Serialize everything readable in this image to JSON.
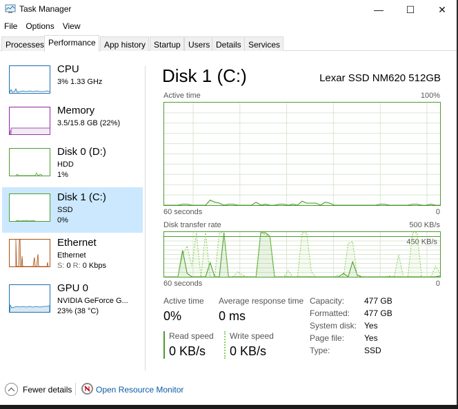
{
  "window": {
    "title": "Task Manager",
    "controls": {
      "minimize": "—",
      "maximize": "☐",
      "close": "✕"
    }
  },
  "menu": [
    "File",
    "Options",
    "View"
  ],
  "tabs": [
    {
      "label": "Processes",
      "active": false
    },
    {
      "label": "Performance",
      "active": true
    },
    {
      "label": "App history",
      "active": false
    },
    {
      "label": "Startup",
      "active": false
    },
    {
      "label": "Users",
      "active": false
    },
    {
      "label": "Details",
      "active": false
    },
    {
      "label": "Services",
      "active": false
    }
  ],
  "sidebar": {
    "items": [
      {
        "name": "CPU",
        "line1": "3% 1.33 GHz",
        "line2": "",
        "color": "#1a6ea8",
        "selected": false
      },
      {
        "name": "Memory",
        "line1": "3.5/15.8 GB (22%)",
        "line2": "",
        "color": "#8b26a0",
        "selected": false
      },
      {
        "name": "Disk 0 (D:)",
        "line1": "HDD",
        "line2": "1%",
        "color": "#4d9a2f",
        "selected": false
      },
      {
        "name": "Disk 1 (C:)",
        "line1": "SSD",
        "line2": "0%",
        "color": "#4d9a2f",
        "selected": true
      },
      {
        "name": "Ethernet",
        "line1": "Ethernet",
        "line2_send_label": "S:",
        "line2_send": "0",
        "line2_recv_label": "R:",
        "line2_recv": "0 Kbps",
        "color": "#a74f0f",
        "selected": false
      },
      {
        "name": "GPU 0",
        "line1": "NVIDIA GeForce G...",
        "line2": "23% (38 °C)",
        "color": "#1a6ea8",
        "selected": false
      }
    ]
  },
  "main": {
    "title": "Disk 1 (C:)",
    "model": "Lexar SSD NM620 512GB",
    "active_chart": {
      "label": "Active time",
      "max_label": "100%",
      "x_left": "60 seconds",
      "x_right": "0"
    },
    "transfer_chart": {
      "label": "Disk transfer rate",
      "max_label": "500 KB/s",
      "ref_label": "450 KB/s",
      "x_left": "60 seconds",
      "x_right": "0"
    },
    "stats": {
      "active_time_label": "Active time",
      "active_time_value": "0%",
      "avg_response_label": "Average response time",
      "avg_response_value": "0 ms",
      "read_label": "Read speed",
      "read_value": "0 KB/s",
      "write_label": "Write speed",
      "write_value": "0 KB/s"
    },
    "info": [
      {
        "key": "Capacity:",
        "value": "477 GB"
      },
      {
        "key": "Formatted:",
        "value": "477 GB"
      },
      {
        "key": "System disk:",
        "value": "Yes"
      },
      {
        "key": "Page file:",
        "value": "Yes"
      },
      {
        "key": "Type:",
        "value": "SSD"
      }
    ]
  },
  "footer": {
    "fewer_details": "Fewer details",
    "resource_monitor": "Open Resource Monitor"
  },
  "chart_data": [
    {
      "type": "line",
      "title": "Active time",
      "ylabel": "%",
      "ylim": [
        0,
        100
      ],
      "xlim": [
        60,
        0
      ],
      "xlabel_left": "60 seconds",
      "xlabel_right": "0",
      "series": [
        {
          "name": "Active time",
          "color": "#4d9a2f",
          "values": [
            0,
            0,
            0,
            0,
            1,
            1,
            0,
            0,
            0,
            0,
            5,
            3,
            2,
            0,
            1,
            1,
            0,
            0,
            0,
            0,
            3,
            0,
            1,
            0,
            0,
            1,
            1,
            0,
            1,
            0,
            4,
            2,
            2,
            2,
            0,
            3,
            2,
            0,
            0,
            0,
            0,
            0,
            0,
            0,
            0,
            0,
            0,
            1,
            1,
            0,
            0,
            0,
            0,
            0,
            1,
            1,
            0,
            0,
            1,
            0,
            0
          ]
        }
      ]
    },
    {
      "type": "line",
      "title": "Disk transfer rate",
      "ylabel": "KB/s",
      "ylim": [
        0,
        500
      ],
      "reference_line": 450,
      "xlim": [
        60,
        0
      ],
      "xlabel_left": "60 seconds",
      "xlabel_right": "0",
      "series": [
        {
          "name": "Read speed",
          "style": "solid",
          "color": "#4d9a2f",
          "values": [
            0,
            0,
            0,
            0,
            300,
            40,
            0,
            0,
            0,
            0,
            160,
            0,
            0,
            500,
            0,
            0,
            0,
            0,
            0,
            0,
            0,
            500,
            500,
            460,
            0,
            0,
            0,
            0,
            0,
            0,
            0,
            0,
            0,
            0,
            0,
            0,
            0,
            0,
            0,
            40,
            0,
            170,
            20,
            0,
            0,
            0,
            0,
            0,
            0,
            0,
            0,
            0,
            0,
            0,
            0,
            0,
            0,
            0,
            0,
            0,
            10
          ]
        },
        {
          "name": "Write speed",
          "style": "dashed",
          "color": "#8ccf5a",
          "values": [
            0,
            0,
            0,
            0,
            250,
            350,
            120,
            500,
            0,
            500,
            0,
            0,
            500,
            500,
            0,
            0,
            60,
            20,
            0,
            0,
            0,
            500,
            480,
            460,
            0,
            0,
            0,
            70,
            0,
            0,
            500,
            500,
            60,
            0,
            0,
            0,
            0,
            0,
            20,
            0,
            380,
            400,
            0,
            0,
            0,
            0,
            0,
            0,
            0,
            10,
            0,
            250,
            0,
            0,
            500,
            500,
            0,
            0,
            0,
            120,
            40
          ]
        }
      ]
    }
  ]
}
